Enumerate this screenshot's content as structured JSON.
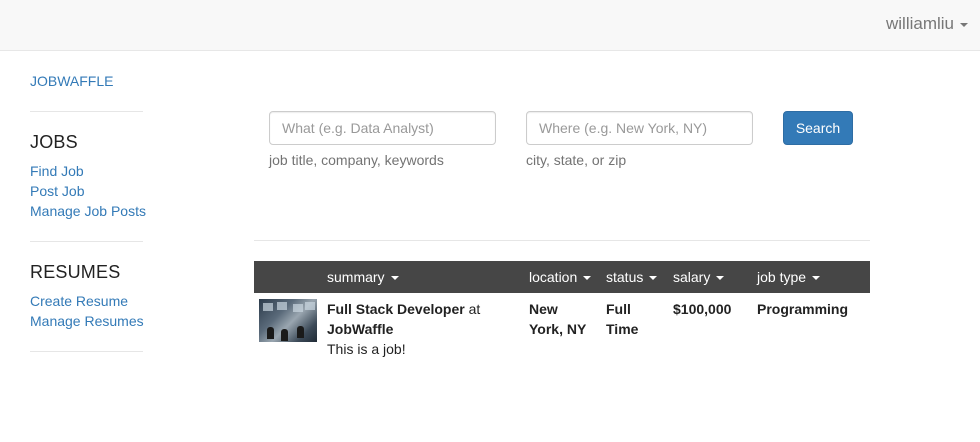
{
  "topbar": {
    "username": "williamliu"
  },
  "sidebar": {
    "brand": "JOBWAFFLE",
    "jobs_title": "JOBS",
    "jobs_links": [
      "Find Job",
      "Post Job",
      "Manage Job Posts"
    ],
    "resumes_title": "RESUMES",
    "resumes_links": [
      "Create Resume",
      "Manage Resumes"
    ]
  },
  "search": {
    "what_placeholder": "What (e.g. Data Analyst)",
    "what_value": "",
    "what_help": "job title, company, keywords",
    "where_placeholder": "Where (e.g. New York, NY)",
    "where_value": "",
    "where_help": "city, state, or zip",
    "button_label": "Search"
  },
  "table": {
    "headers": [
      "summary",
      "location",
      "status",
      "salary",
      "job type"
    ],
    "rows": [
      {
        "title": "Full Stack Developer",
        "at": "at",
        "company": "JobWaffle",
        "description": "This is a job!",
        "location_line1": "New",
        "location_line2": "York, NY",
        "status_line1": "Full",
        "status_line2": "Time",
        "salary": "$100,000",
        "job_type": "Programming"
      }
    ]
  },
  "colors": {
    "link": "#337ab7",
    "header_bg": "#464646",
    "button": "#337ab7"
  }
}
